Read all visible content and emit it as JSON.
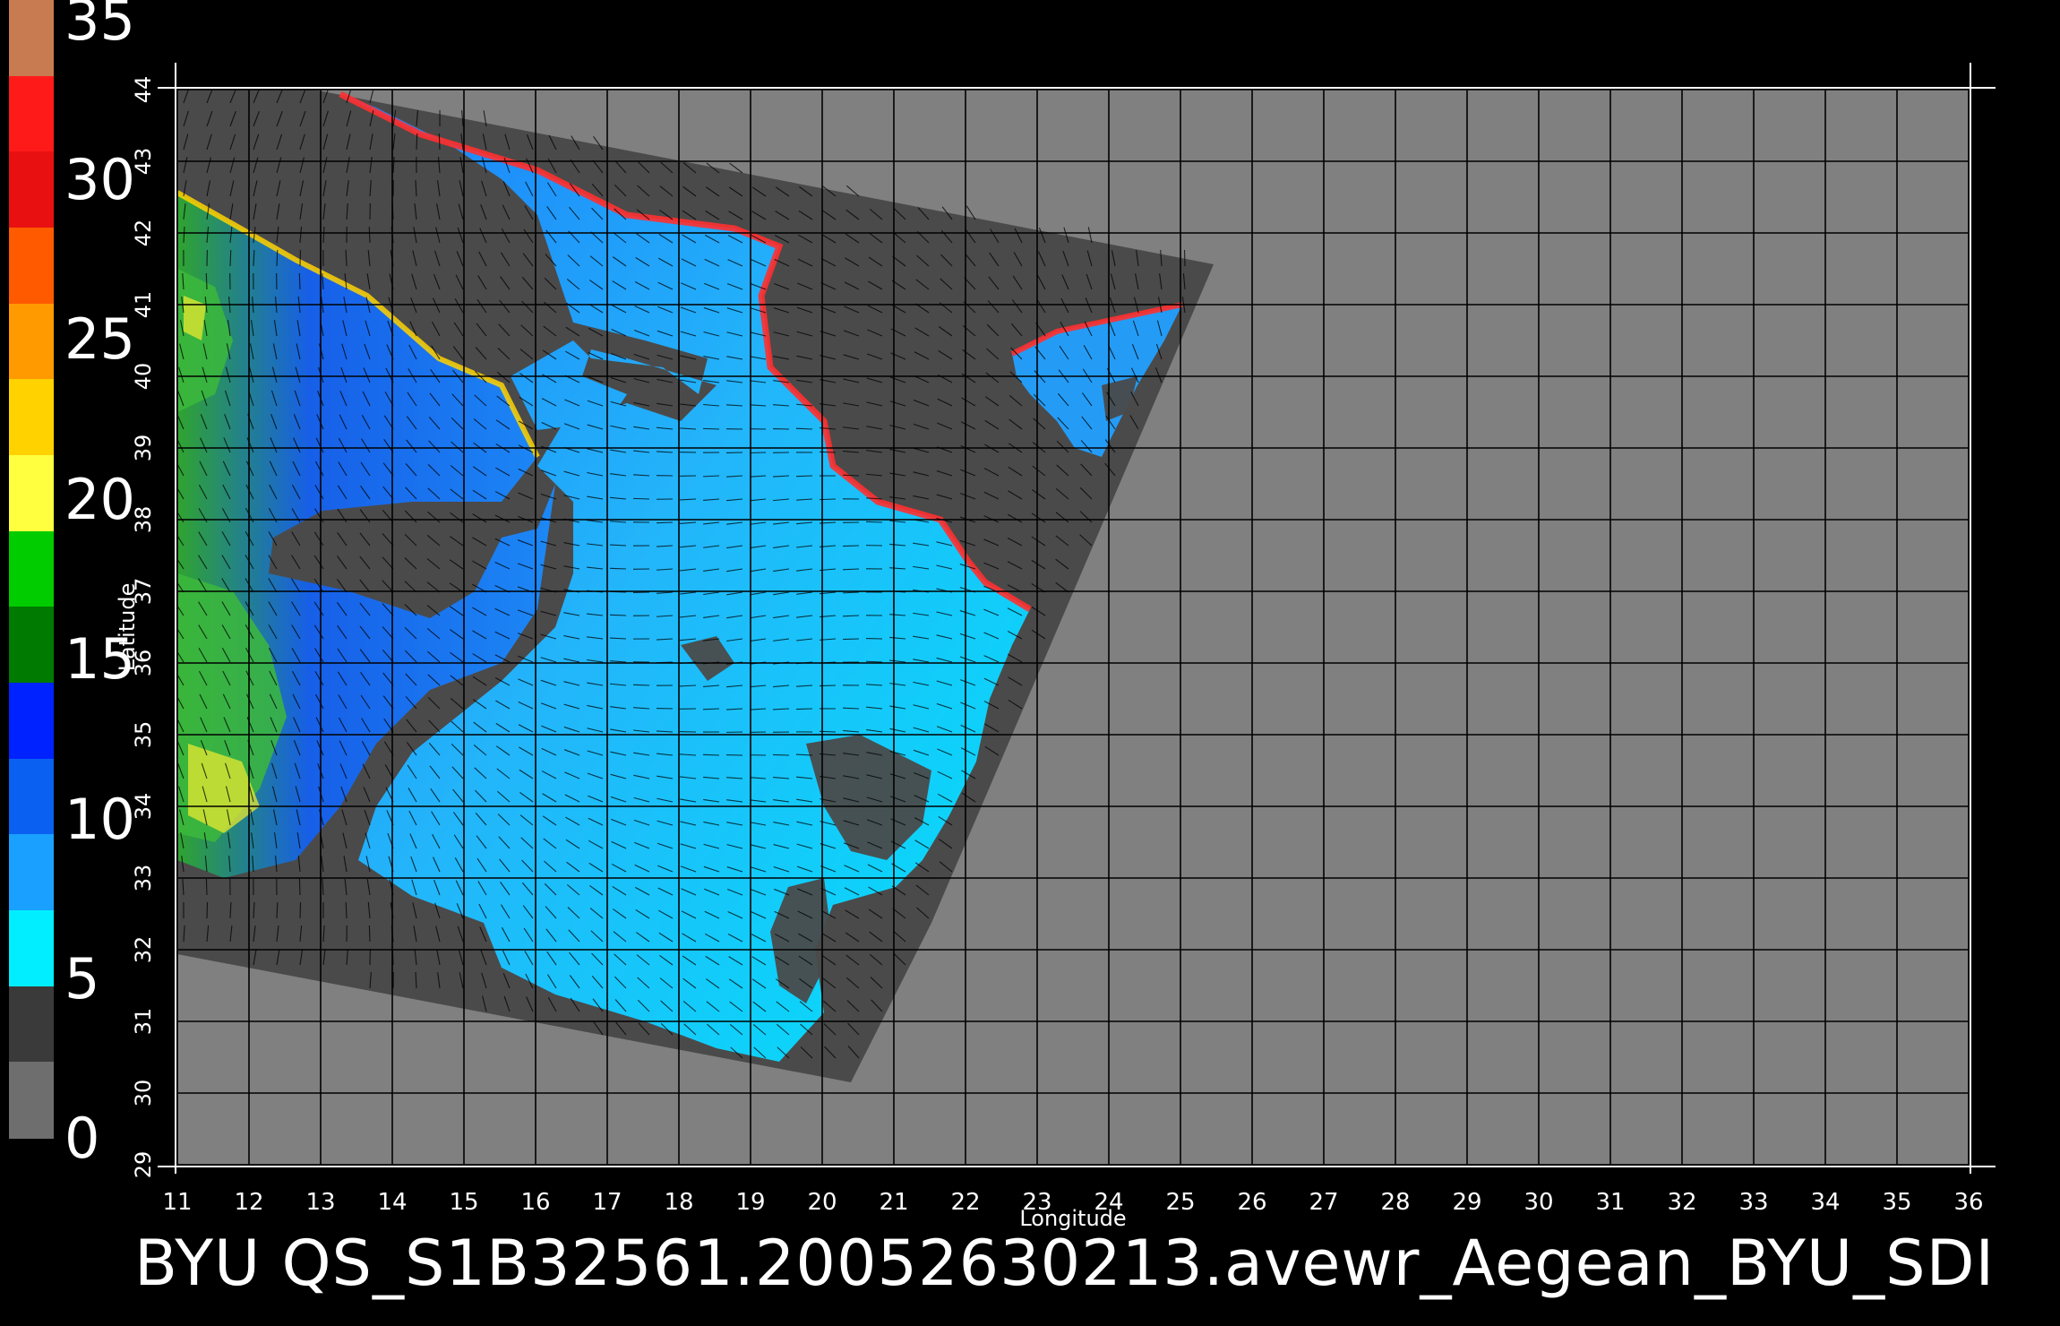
{
  "colorbar": {
    "labels": [
      "35",
      "30",
      "25",
      "20",
      "15",
      "10",
      "5",
      "0"
    ],
    "segments": [
      {
        "color": "#c87a50"
      },
      {
        "color": "#ff1a1a"
      },
      {
        "color": "#e81010"
      },
      {
        "color": "#ff5a00"
      },
      {
        "color": "#ff9a00"
      },
      {
        "color": "#ffd200"
      },
      {
        "color": "#ffff40"
      },
      {
        "color": "#00cc00"
      },
      {
        "color": "#007a00"
      },
      {
        "color": "#0022ff"
      },
      {
        "color": "#0a60f0"
      },
      {
        "color": "#1aa0ff"
      },
      {
        "color": "#00eeff"
      },
      {
        "color": "#3a3a3a"
      },
      {
        "color": "#6e6e6e"
      }
    ]
  },
  "map": {
    "x_axis_label": "Longitude",
    "y_axis_label": "Latitude",
    "x_ticks": [
      "11",
      "12",
      "13",
      "14",
      "15",
      "16",
      "17",
      "18",
      "19",
      "20",
      "21",
      "22",
      "23",
      "24",
      "25",
      "26",
      "27",
      "28",
      "29",
      "30",
      "31",
      "32",
      "33",
      "34",
      "35",
      "36"
    ],
    "y_ticks": [
      "29",
      "30",
      "31",
      "32",
      "33",
      "34",
      "35",
      "36",
      "37",
      "38",
      "39",
      "40",
      "41",
      "42",
      "43",
      "44"
    ],
    "lon_range": [
      11,
      36
    ],
    "lat_range": [
      29,
      44
    ],
    "background_color": "#808080",
    "swath_color": "#4a4a4a",
    "grid_color": "#000000"
  },
  "footer": {
    "caption": "BYU  QS_S1B32561.20052630213.avewr_Aegean_BYU_SDI"
  }
}
